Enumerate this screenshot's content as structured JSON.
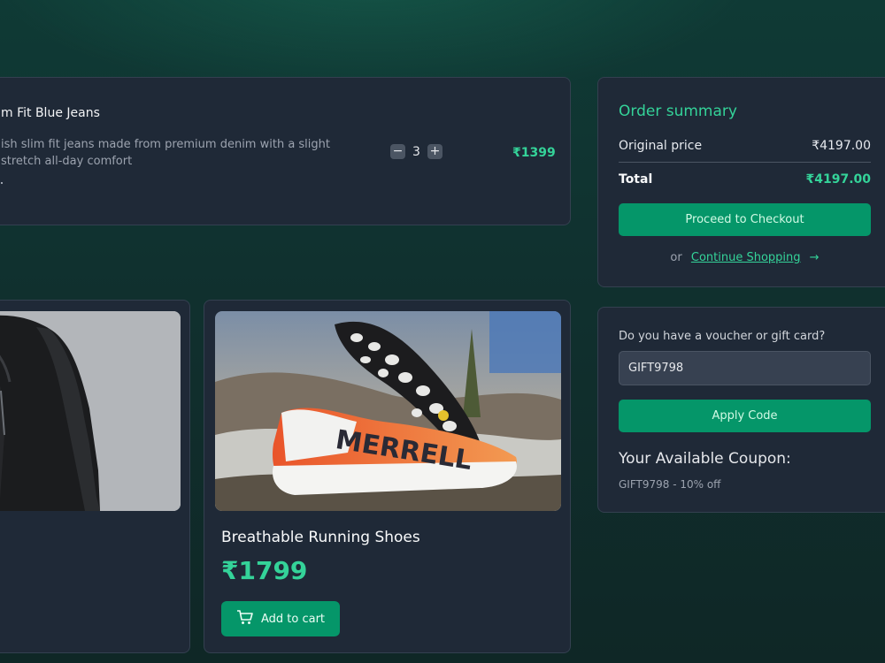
{
  "cart_item": {
    "name": "m Fit Blue Jeans",
    "description": "ish slim fit jeans made from premium denim with a slight stretch all-day comfort",
    "quantity": "3",
    "minus_symbol": "−",
    "plus_symbol": "+",
    "price": "₹1399"
  },
  "products": [
    {
      "image": "leather-jacket-photo"
    },
    {
      "image": "running-shoes-photo",
      "name": "Breathable Running Shoes",
      "price": "₹1799",
      "add_to_cart_label": "Add to cart",
      "brand_text": "MERRELL"
    }
  ],
  "order_summary": {
    "title": "Order summary",
    "original_price_label": "Original price",
    "original_price_value": "₹4197.00",
    "total_label": "Total",
    "total_value": "₹4197.00",
    "checkout_label": "Proceed to Checkout",
    "or_text": "or",
    "continue_label": "Continue Shopping",
    "continue_arrow": "→"
  },
  "voucher": {
    "label": "Do you have a voucher or gift card?",
    "input_value": "GIFT9798",
    "apply_label": "Apply Code",
    "coupons_title": "Your Available Coupon:",
    "coupon_text": "GIFT9798 - 10% off"
  },
  "colors": {
    "accent": "#34d399",
    "button": "#059669",
    "card": "#1f2937",
    "background": "#10312f"
  },
  "icons": {
    "cart": "shopping-cart-icon"
  }
}
